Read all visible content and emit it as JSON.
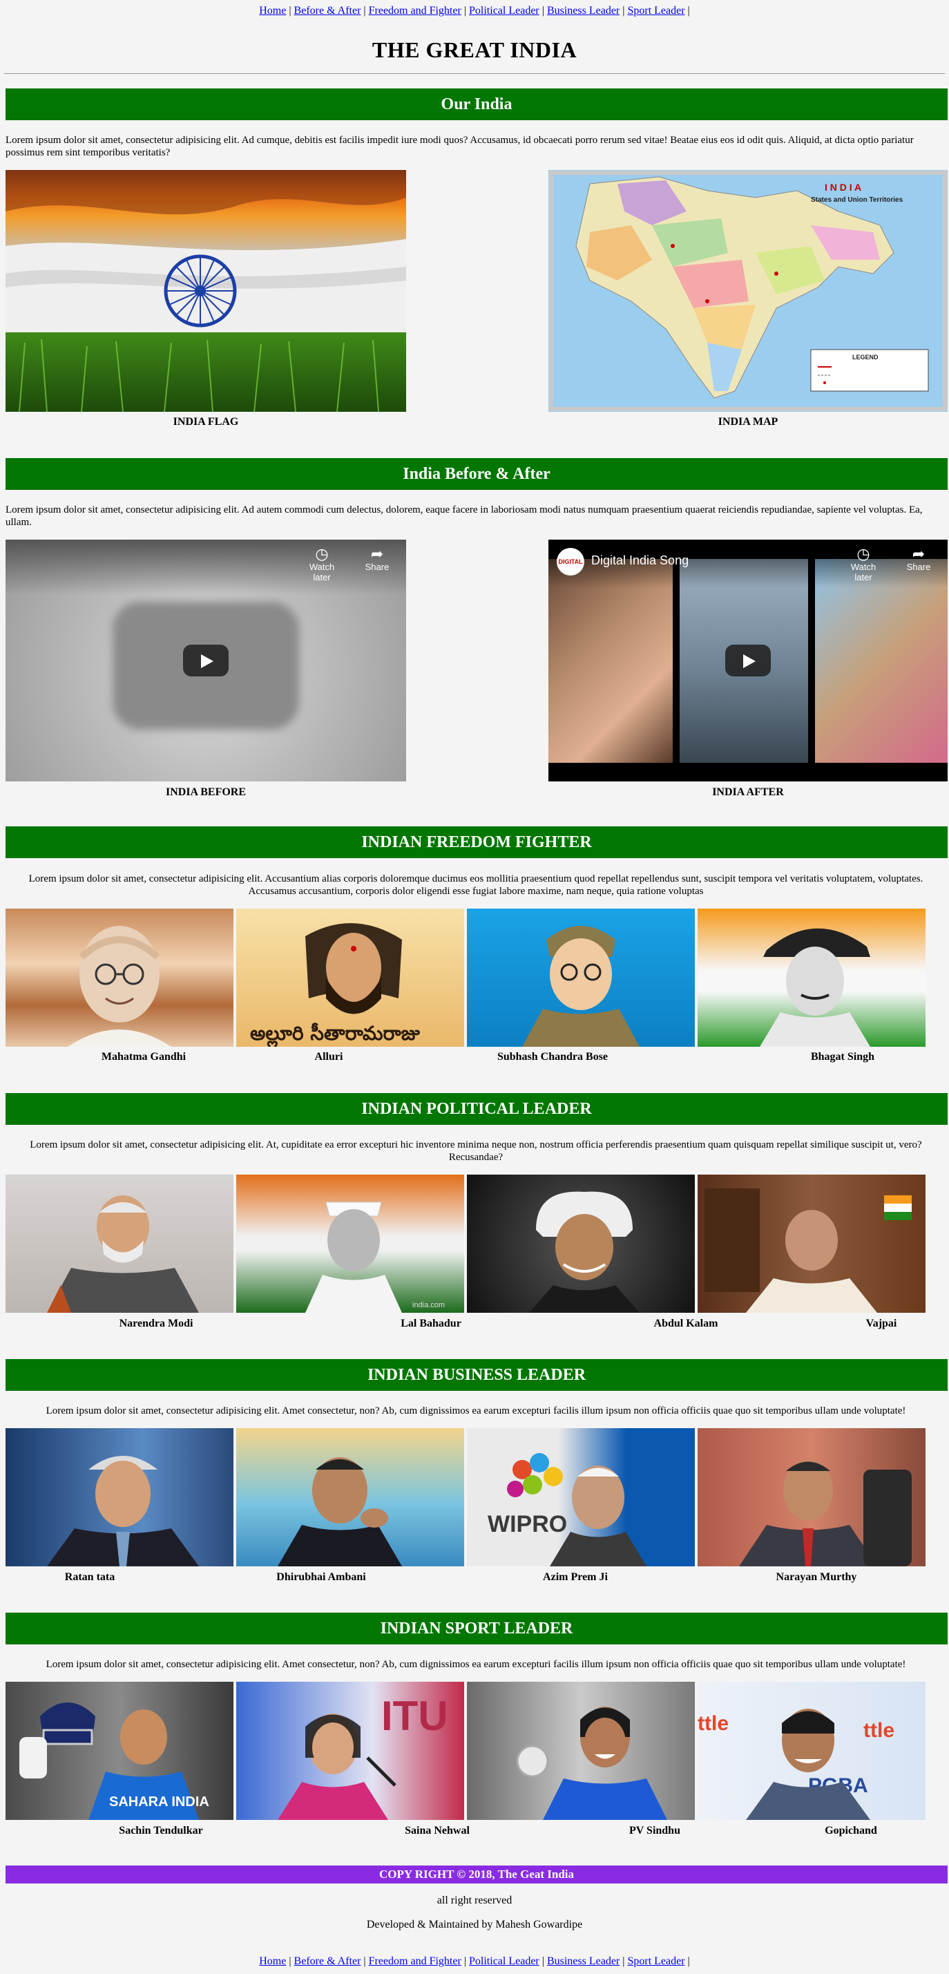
{
  "nav": {
    "items": [
      {
        "label": "Home"
      },
      {
        "label": "Before & After"
      },
      {
        "label": "Freedom and Fighter"
      },
      {
        "label": "Political Leader"
      },
      {
        "label": "Business Leader"
      },
      {
        "label": "Sport Leader"
      }
    ]
  },
  "site_title": "THE GREAT INDIA",
  "sections": {
    "our_india": {
      "heading": "Our India",
      "text": "Lorem ipsum dolor sit amet, consectetur adipisicing elit. Ad cumque, debitis est facilis impedit iure modi quos? Accusamus, id obcaecati porro rerum sed vitae! Beatae eius eos id odit quis. Aliquid, at dicta optio pariatur possimus rem sint temporibus veritatis?",
      "captions": [
        "INDIA FLAG",
        "INDIA MAP"
      ],
      "map_title": "I N D I A",
      "map_subtitle": "States and Union Territories",
      "map_legend": "LEGEND"
    },
    "before_after": {
      "heading": "India Before & After",
      "text": "Lorem ipsum dolor sit amet, consectetur adipisicing elit. Ad autem commodi cum delectus, dolorem, eaque facere in laboriosam modi natus numquam praesentium quaerat reiciendis repudiandae, sapiente vel voluptas. Ea, ullam.",
      "captions": [
        "INDIA BEFORE",
        "INDIA AFTER"
      ],
      "video2_title": "Digital India Song",
      "watch_later": "Watch later",
      "share": "Share"
    },
    "freedom": {
      "heading": "INDIAN FREEDOM FIGHTER",
      "text": "Lorem ipsum dolor sit amet, consectetur adipisicing elit. Accusantium alias corporis doloremque ducimus eos mollitia praesentium quod repellat repellendus sunt, suscipit tempora vel veritatis voluptatem, voluptates. Accusamus accusantium, corporis dolor eligendi esse fugiat labore maxime, nam neque, quia ratione voluptas",
      "people": [
        "Mahatma Gandhi",
        "Alluri",
        "Subhash Chandra Bose",
        "Bhagat Singh"
      ]
    },
    "political": {
      "heading": "INDIAN POLITICAL LEADER",
      "text": "Lorem ipsum dolor sit amet, consectetur adipisicing elit. At, cupiditate ea error excepturi hic inventore minima neque non, nostrum officia perferendis praesentium quam quisquam repellat similique suscipit ut, vero? Recusandae?",
      "people": [
        "Narendra Modi",
        "Lal Bahadur",
        "Abdul Kalam",
        "Vajpai"
      ],
      "watermark": "india.com"
    },
    "business": {
      "heading": "INDIAN BUSINESS LEADER",
      "text": "Lorem ipsum dolor sit amet, consectetur adipisicing elit. Amet consectetur, non? Ab, cum dignissimos ea earum excepturi facilis illum ipsum non officia officiis quae quo sit temporibus ullam unde voluptate!",
      "people": [
        "Ratan tata",
        "Dhirubhai Ambani",
        "Azim Prem Ji",
        "Narayan Murthy"
      ],
      "wipro": "WIPRO"
    },
    "sport": {
      "heading": "INDIAN SPORT LEADER",
      "text": "Lorem ipsum dolor sit amet, consectetur adipisicing elit. Amet consectetur, non? Ab, cum dignissimos ea earum excepturi facilis illum ipsum non officia officiis quae quo sit temporibus ullam unde voluptate!",
      "people": [
        "Sachin Tendulkar",
        "Saina Nehwal",
        "PV Sindhu",
        "Gopichand"
      ],
      "jersey": "SAHARA INDIA",
      "backdrop": "PGBA"
    }
  },
  "footer": {
    "copyright": "COPY RIGHT © 2018, The Geat India",
    "rights": "all right reserved",
    "developer": "Developed & Maintained by Mahesh Gowardipe"
  },
  "colors": {
    "band_green": "#017601",
    "footer_purple": "#8a2be2",
    "background": "#f4f4f4"
  }
}
